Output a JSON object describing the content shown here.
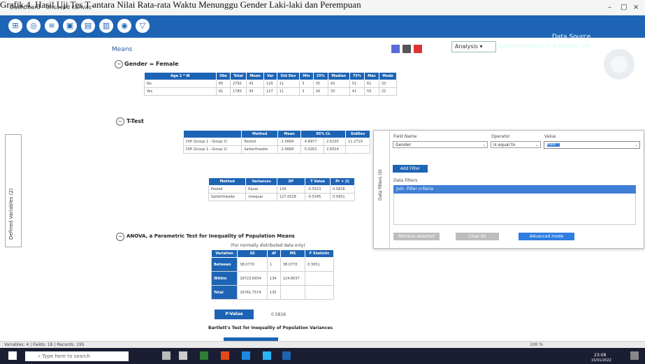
{
  "caption": "Grafik 4. Hasil Uji Tes T antara Nilai Rata-rata Waktu Menunggu Gender Laki-laki dan Perempuan",
  "window": {
    "title": "Dashboard - Unsaved canvas*"
  },
  "toolbar": {
    "analysis_label": "Analysis",
    "data_source_title": "Data Source",
    "data_source_info": "SatisfactionSurvey_Final   Records: 195"
  },
  "left_tab": {
    "label": "Defined Variables (2)"
  },
  "means": {
    "title": "Means",
    "group_heading": "Gender = Female",
    "table": {
      "headers": [
        "Age 1 * W",
        "Obs",
        "Total",
        "Mean",
        "Var",
        "Std Dev",
        "Min",
        "25%",
        "Median",
        "75%",
        "Max",
        "Mode"
      ],
      "rows": [
        [
          "No",
          "65",
          "2792",
          "43",
          "120",
          "11",
          "3",
          "35",
          "43",
          "51",
          "61",
          "33"
        ],
        [
          "Yes",
          "61",
          "1780",
          "34",
          "127",
          "11",
          "3",
          "24",
          "33",
          "41",
          "55",
          "22"
        ]
      ]
    }
  },
  "ttest": {
    "heading": "T-Test",
    "t1": {
      "headers": [
        "",
        "Method",
        "Mean",
        "95% CL",
        "StdDev"
      ],
      "rows": [
        [
          "Diff (Group 1 - Group 2)",
          "Pooled",
          "-1.0684",
          "-4.8977",
          "2.6105",
          "11.2719"
        ],
        [
          "Diff (Group 1 - Group 2)",
          "Satterthwaite",
          "-1.0684",
          "-5.0262",
          "2.8314",
          ""
        ]
      ]
    },
    "t2": {
      "headers": [
        "Method",
        "Variances",
        "DF",
        "T Value",
        "Pr > |t|"
      ],
      "rows": [
        [
          "Pooled",
          "Equal",
          "134",
          "-0.5523",
          "0.5816"
        ],
        [
          "Satterthwaite",
          "Unequal",
          "127.0528",
          "-0.5345",
          "0.5951"
        ]
      ]
    }
  },
  "anova": {
    "heading": "ANOVA, a Parametric Test for Inequality of Population Means",
    "note": "(For normally distributed data only)",
    "headers": [
      "Variation",
      "SS",
      "df",
      "MS",
      "F Statistic"
    ],
    "rows": [
      [
        "Between",
        "38.0770",
        "1",
        "38.0770",
        "0.3051"
      ],
      [
        "Within",
        "16723.6934",
        "134",
        "124.8037",
        ""
      ],
      [
        "Total",
        "16761.7574",
        "135",
        "",
        ""
      ]
    ],
    "pvalue_label": "P-Value",
    "pvalue": "0.5816",
    "bartlett": "Bartlett's Test for Inequality of Population Variances"
  },
  "filter": {
    "side_label": "Data Filters (0)",
    "field_name_label": "Field Name",
    "field_name_value": "Gender",
    "operator_label": "Operator",
    "operator_value": "is equal to",
    "value_label": "Value",
    "value_selected": "Male",
    "add_filter": "Add Filter",
    "data_filters_label": "Data Filters",
    "col_join": "Join",
    "col_criteria": "Filter criteria",
    "remove_selected": "Remove selected",
    "clear_all": "Clear All",
    "advanced_mode": "Advanced mode"
  },
  "status": {
    "left": "Variables: 4 | Fields: 18 | Records: 195",
    "zoom": "100 %"
  },
  "taskbar": {
    "search_placeholder": "Type here to search",
    "time": "23:08",
    "date": "15/01/2022"
  }
}
